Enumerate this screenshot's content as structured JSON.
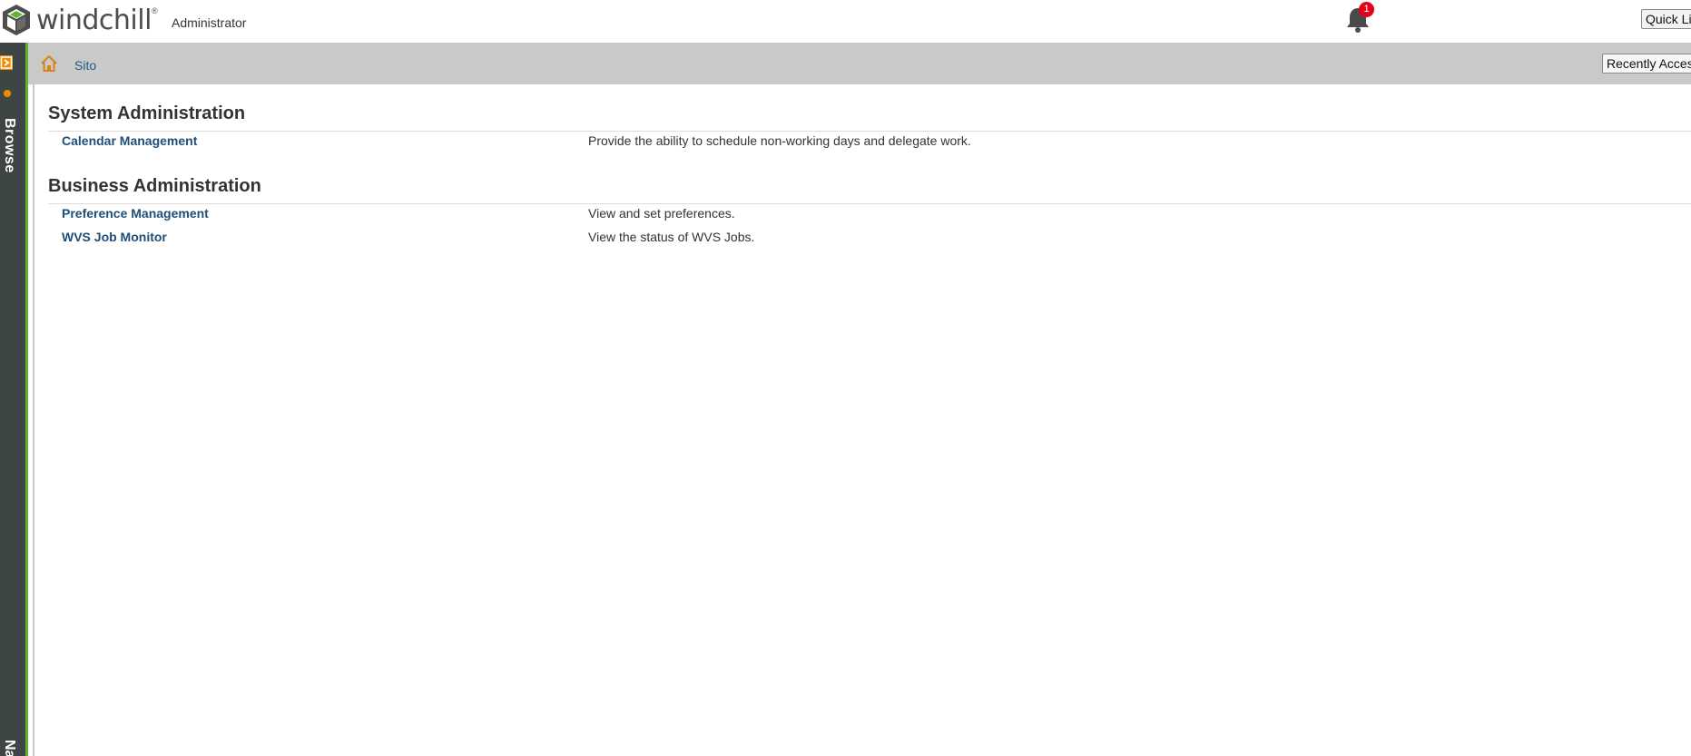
{
  "header": {
    "logo_text": "windchill",
    "logo_mark": "®",
    "user_role": "Administrator",
    "notification_count": "1",
    "quick_links_label": "Quick Links"
  },
  "navigator": {
    "browse_label": "Browse",
    "bottom_label": "Na"
  },
  "breadcrumb": {
    "site_label": "Sito",
    "recently_accessed_label": "Recently Accessed"
  },
  "sections": [
    {
      "title": "System Administration",
      "items": [
        {
          "label": "Calendar Management",
          "description": "Provide the ability to schedule non-working days and delegate work."
        }
      ]
    },
    {
      "title": "Business Administration",
      "items": [
        {
          "label": "Preference Management",
          "description": "View and set preferences."
        },
        {
          "label": "WVS Job Monitor",
          "description": "View the status of WVS Jobs."
        }
      ]
    }
  ],
  "colors": {
    "accent_orange": "#f08b00",
    "nav_dark": "#3e4545",
    "nav_edge_green": "#5ab52f",
    "link_blue": "#1f4e79",
    "badge_red": "#e3001b"
  }
}
